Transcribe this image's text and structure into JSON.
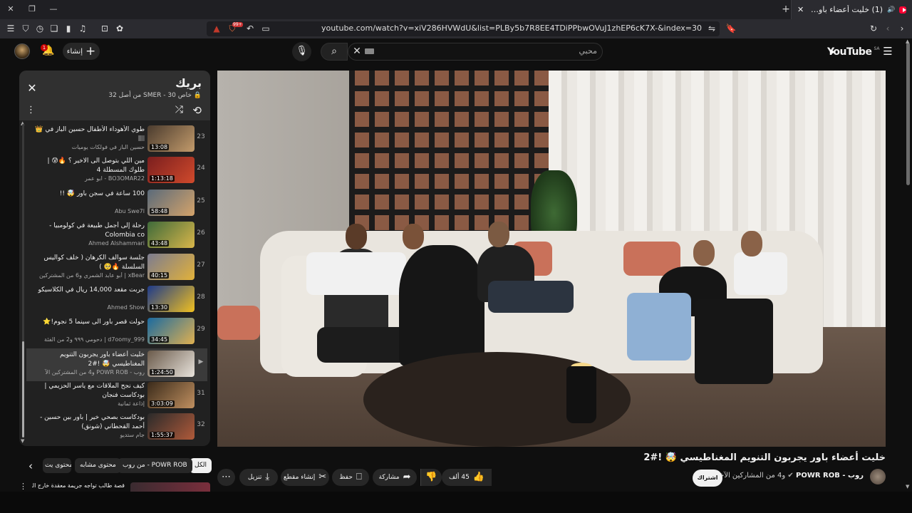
{
  "browser": {
    "tab_title": "(1) خليت أعضاء باور يجربون التنـ",
    "url": "youtube.com/watch?v=xiV286HVWdU&list=PLBy5b7R8EE4TDiPPbwOVuJ1zhEP6cK7X-&index=30",
    "shield_badge": "99+"
  },
  "header": {
    "logo": "YouTube",
    "country": "SA",
    "search_value": "محبي",
    "create_label": "إنشاء",
    "notification_count": "1"
  },
  "playlist": {
    "title": "بريك",
    "meta": "خاص SMER - 30 من أصل 32",
    "items": [
      {
        "index": "23",
        "title": "طوي الأهوداء الأطفال حسين الباز في 👑🏽",
        "channel": "حسين الباز في فولكات يوميات",
        "duration": "13:08",
        "tc1": "#4a3b2e",
        "tc2": "#c39b6b"
      },
      {
        "index": "24",
        "title": "مين اللي بتوصل الى الاخير ؟ 🔥😰 | طلوك المسطلة 4",
        "channel": "BO3OMAR22 - ابو عمر",
        "duration": "1:13:18",
        "tc1": "#7a1e1e",
        "tc2": "#d04a2c"
      },
      {
        "index": "25",
        "title": "100 ساعة في سجن باور 🤯 !!",
        "channel": "Abu Swe7l",
        "duration": "58:48",
        "tc1": "#5a6a7a",
        "tc2": "#d4a36a"
      },
      {
        "index": "26",
        "title": "رحلة إلى أجمل طبيعة في كولومبيا - Colombia co",
        "channel": "Ahmed Alshammari",
        "duration": "43:48",
        "tc1": "#3e6a3a",
        "tc2": "#d9b64a"
      },
      {
        "index": "27",
        "title": "جلسة سوالف الكرهان ( خلف كواليس السلسلة 🔥🥺 )",
        "channel": "xBear | أبو عابد الشمري و6 من المشتركين",
        "duration": "40:15",
        "tc1": "#7c7c90",
        "tc2": "#e2b13a"
      },
      {
        "index": "28",
        "title": "جربت مقعد 14,000 ريال في الكلاسيكو",
        "channel": "Ahmed Show",
        "duration": "13:30",
        "tc1": "#1e3a8a",
        "tc2": "#f0c020"
      },
      {
        "index": "29",
        "title": "حولت قصر باور الى سينما 5 نجوم!⭐",
        "channel": "d7oomy_999 | دحومي ٩٩٩ و2 من الفئة",
        "duration": "34:45",
        "tc1": "#1a6aa0",
        "tc2": "#e0b050"
      },
      {
        "index": "▶",
        "title": "خليت أعضاء باور يجربون التنويم المغناطيسي 🤯 !#2",
        "channel": "روب - POWR ROB و4 من المشتركين الآ",
        "duration": "1:24:50",
        "tc1": "#6a5a4a",
        "tc2": "#e8e3dc"
      },
      {
        "index": "31",
        "title": "كيف نجح الملاقات مع ياسر الحزيمي | بودكاست فنجان",
        "channel": "إذاعة ثمانية",
        "duration": "3:03:09",
        "tc1": "#3a2a1a",
        "tc2": "#c09060"
      },
      {
        "index": "32",
        "title": "بودكاست بصحي خير | باور بين حسين - أحمد القحطاني (شونق)",
        "channel": "جام ستديو",
        "duration": "1:55:37",
        "tc1": "#2a2a2a",
        "tc2": "#b05a3a"
      }
    ]
  },
  "chips": [
    "الكل",
    "من روب - POWR ROB",
    "محتوى مشابه",
    "محتوى يت"
  ],
  "video": {
    "title": "خليت أعضاء باور يجربون التنويم المغناطيسي 🤯 !#2",
    "channel": "روب - POWR ROB",
    "channel_extra": "و4 من المشاركين الآخرين",
    "subscribe_label": "اشتراك",
    "likes": "45 ألف",
    "share_label": "مشاركة",
    "save_label": "حفظ",
    "clip_label": "إنشاء مقطع",
    "download_label": "تنزيل"
  },
  "recommendation": {
    "title": "قصة طالب تواجه جريمة معقدة خارج الدولة ("
  }
}
